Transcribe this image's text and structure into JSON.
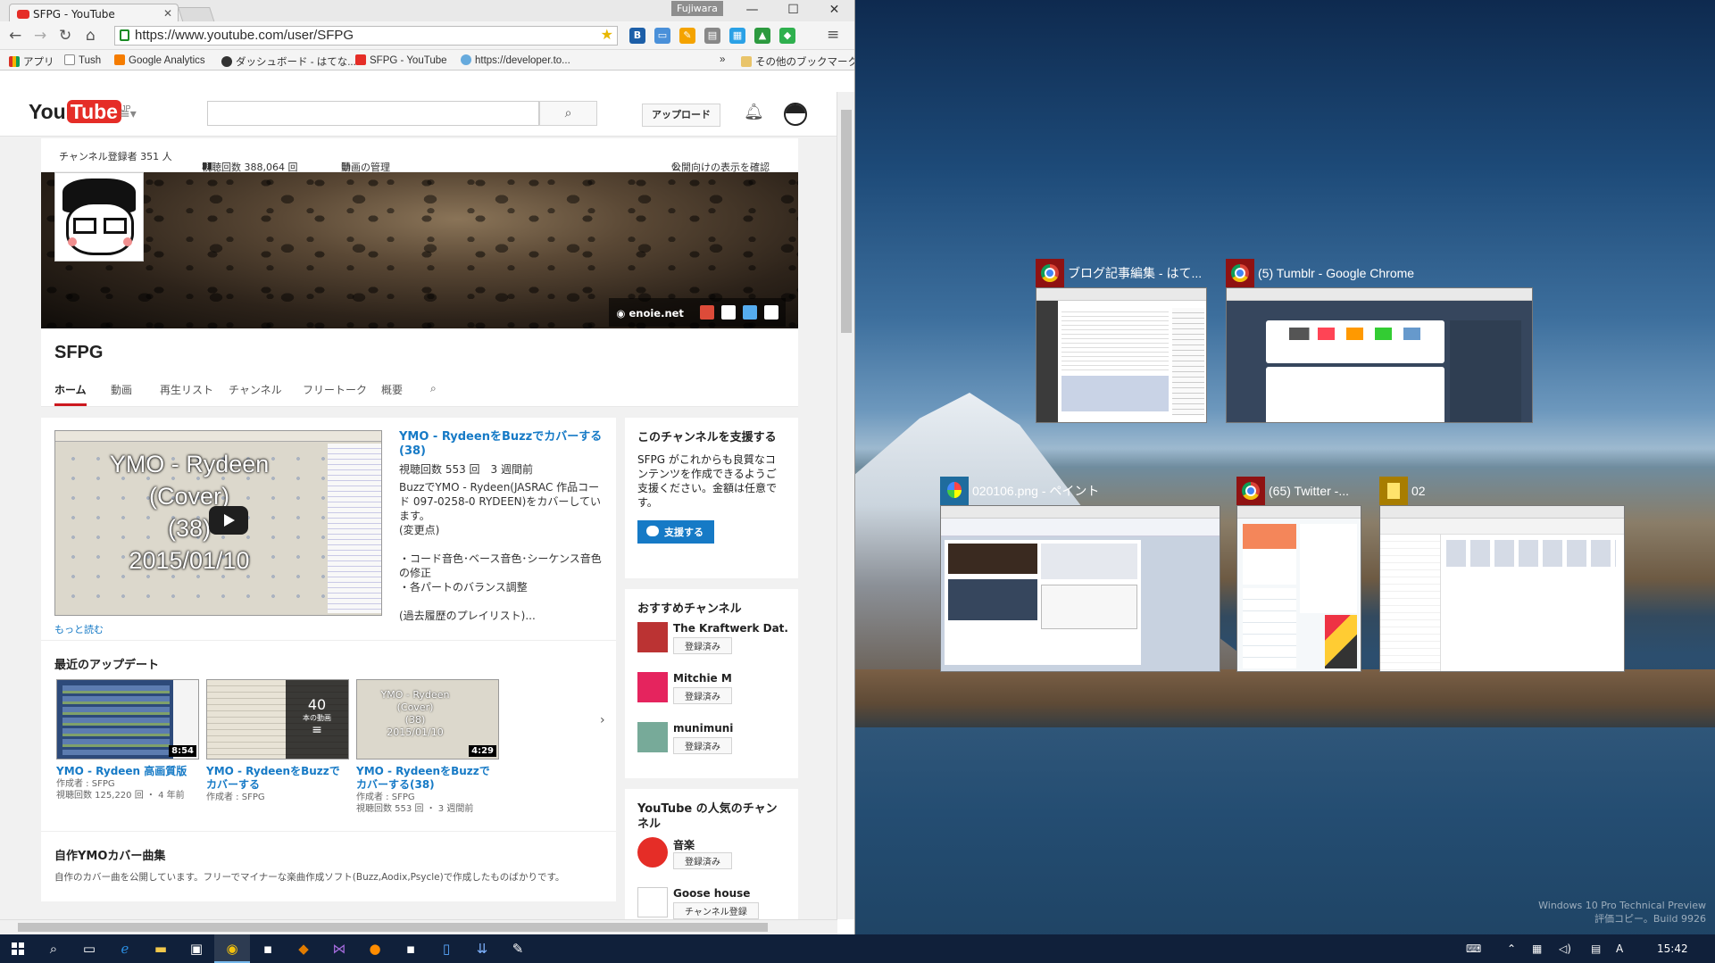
{
  "browser": {
    "tab_title": "SFPG - YouTube",
    "user_badge": "Fujiwara",
    "url": "https://www.youtube.com/user/SFPG",
    "window_controls": {
      "minimize": "—",
      "maximize": "☐",
      "close": "✕"
    },
    "bookmarks": [
      {
        "label": "アプリ",
        "icon_color": "#d93025"
      },
      {
        "label": "Tush",
        "icon_color": "#ffffff"
      },
      {
        "label": "Google Analytics",
        "icon_color": "#f57c00"
      },
      {
        "label": "ダッシュボード - はてな...",
        "icon_color": "#333333"
      },
      {
        "label": "SFPG - YouTube",
        "icon_color": "#e52d27"
      },
      {
        "label": "https://developer.to...",
        "icon_color": "#66aadd"
      }
    ],
    "bookmarks_overflow": "»",
    "other_bookmarks": "その他のブックマーク"
  },
  "youtube": {
    "logo_you": "You",
    "logo_tube": "Tube",
    "logo_region": "JP",
    "upload_label": "アップロード",
    "channel": {
      "subscribers": "チャンネル登録者 351 人",
      "views": "視聴回数 388,064 回",
      "manage": "動画の管理",
      "public_view": "公開向けの表示を確認",
      "banner_link": "enoie.net",
      "name": "SFPG",
      "tabs": [
        "ホーム",
        "動画",
        "再生リスト",
        "チャンネル",
        "フリートーク",
        "概要"
      ]
    },
    "featured": {
      "thumb_text_1": "YMO - Rydeen",
      "thumb_text_2": "(Cover)",
      "thumb_text_3": "(38)",
      "thumb_text_4": "2015/01/10",
      "title": "YMO - RydeenをBuzzでカバーする(38)",
      "meta": "視聴回数 553 回　3 週間前",
      "desc_1": "BuzzでYMO - Rydeen(JASRAC 作品コード 097-0258-0 RYDEEN)をカバーしています。",
      "desc_2": "(変更点)",
      "desc_3": "・コード音色･ベース音色･シーケンス音色の修正",
      "desc_4": "・各パートのバランス調整",
      "desc_5": "(過去履歴のプレイリスト)...",
      "more": "もっと読む"
    },
    "recent": {
      "title": "最近のアップデート",
      "items": [
        {
          "duration": "8:54",
          "title": "YMO - Rydeen 高画質版",
          "author": "作成者 : SFPG",
          "stats": "視聴回数 125,220 回 ・ 4 年前"
        },
        {
          "playlist_count": "40",
          "playlist_label": "本の動画",
          "title": "YMO - RydeenをBuzzでカバーする",
          "author": "作成者 : SFPG",
          "stats": ""
        },
        {
          "duration": "4:29",
          "title": "YMO - RydeenをBuzzでカバーする(38)",
          "author": "作成者 : SFPG",
          "stats": "視聴回数 553 回 ・ 3 週間前"
        }
      ]
    },
    "covers": {
      "title": "自作YMOカバー曲集",
      "desc": "自作のカバー曲を公開しています。フリーでマイナーな楽曲作成ソフト(Buzz,Aodix,Psycle)で作成したものばかりです。"
    },
    "support": {
      "title": "このチャンネルを支援する",
      "text": "SFPG がこれからも良質なコンテンツを作成できるようご支援ください。金額は任意です。",
      "button": "支援する"
    },
    "recommended": {
      "title": "おすすめチャンネル",
      "items": [
        {
          "name": "The Kraftwerk Dat...",
          "button": "登録済み",
          "color": "#b33"
        },
        {
          "name": "Mitchie M",
          "button": "登録済み",
          "color": "#e5245e"
        },
        {
          "name": "munimuni",
          "button": "登録済み",
          "color": "#7a9"
        }
      ]
    },
    "popular": {
      "title": "YouTube の人気のチャンネル",
      "items": [
        {
          "name": "音楽",
          "button": "登録済み",
          "color": "#e52d27"
        },
        {
          "name": "Goose house",
          "button": "チャンネル登録",
          "color": "#ffffff"
        }
      ]
    }
  },
  "task_view": [
    {
      "title": "ブログ記事編集 - はて...",
      "icon": "chrome-icon"
    },
    {
      "title": "(5) Tumblr - Google Chrome",
      "icon": "chrome-icon"
    },
    {
      "title": "020106.png - ペイント",
      "icon": "paint-icon"
    },
    {
      "title": "(65) Twitter -...",
      "icon": "chrome-icon"
    },
    {
      "title": "02",
      "icon": "notes-icon"
    }
  ],
  "desktop": {
    "watermark_1": "Windows 10 Pro Technical Preview",
    "watermark_2": "評価コピー。Build 9926"
  },
  "taskbar": {
    "clock": "15:42",
    "ime": "A"
  }
}
